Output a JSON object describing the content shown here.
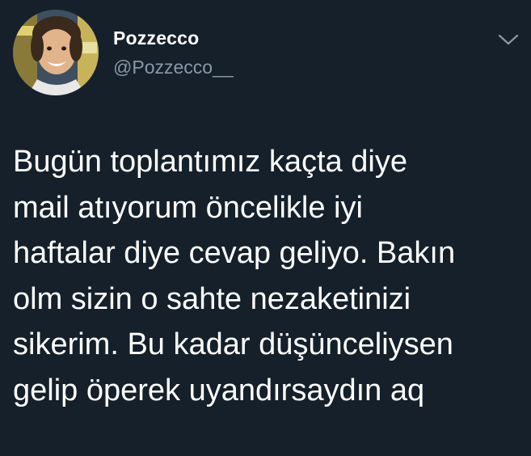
{
  "author": {
    "display_name": "Pozzecco",
    "handle": "@Pozzecco__",
    "avatar_icon": "profile-photo"
  },
  "actions": {
    "more_icon": "chevron-down-icon"
  },
  "tweet": {
    "lines": [
      "Bugün toplantımız kaçta diye",
      "mail atıyorum öncelikle iyi",
      "haftalar diye cevap geliyo. Bakın",
      "olm sizin o sahte nezaketinizi",
      "sikerim. Bu kadar düşünceliysen",
      "gelip öperek uyandırsaydın aq"
    ]
  },
  "colors": {
    "background": "#15202b",
    "text_primary": "#ffffff",
    "text_secondary": "#8899a6"
  }
}
